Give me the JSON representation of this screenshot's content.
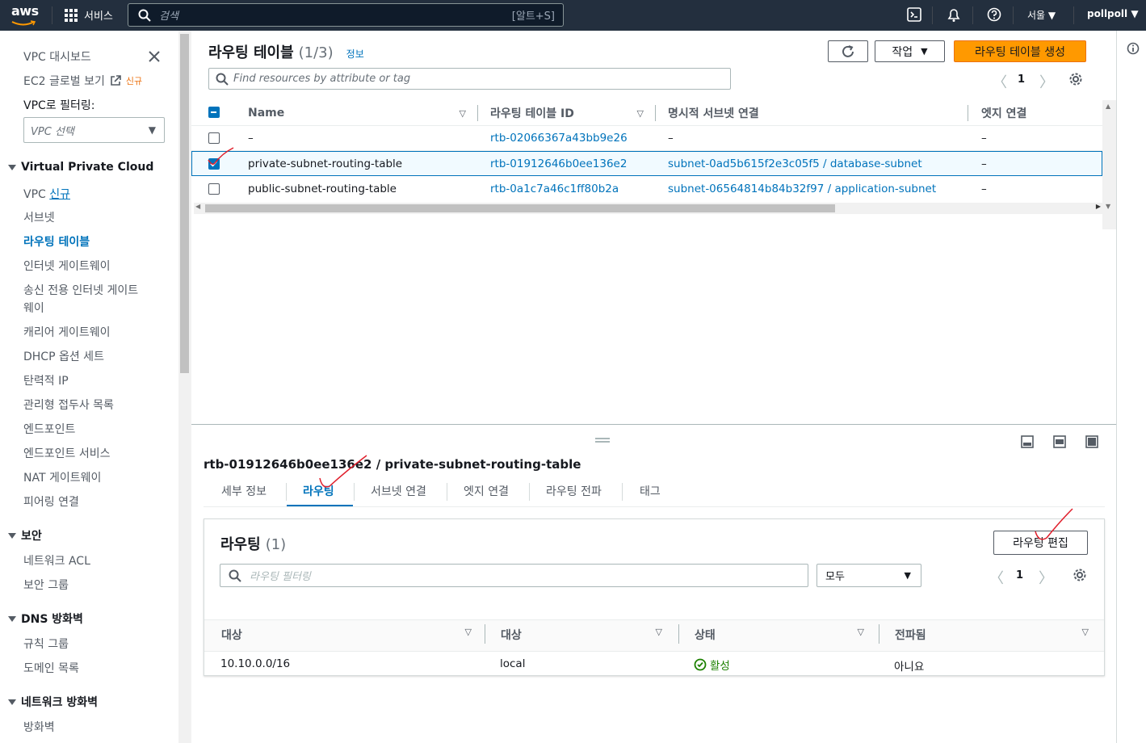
{
  "topbar": {
    "logo": "aws",
    "services_label": "서비스",
    "search_placeholder": "검색",
    "search_shortcut": "[알트+S]",
    "region": "서울",
    "user": "pollpoll"
  },
  "sidebar": {
    "dashboard": "VPC 대시보드",
    "global_view": "EC2 글로벌 보기",
    "global_view_badge": "신규",
    "filter_label": "VPC로 필터링:",
    "filter_placeholder": "VPC 선택",
    "sections": [
      {
        "title": "Virtual Private Cloud"
      },
      {
        "title": "보안"
      },
      {
        "title": "DNS 방화벽"
      },
      {
        "title": "네트워크 방화벽"
      }
    ],
    "vpc_items": {
      "vpc": "VPC",
      "vpc_badge": "신규",
      "subnet": "서브넷",
      "route_tables": "라우팅 테이블",
      "igw": "인터넷 게이트웨이",
      "eigw_1": "송신 전용 인터넷 게이트",
      "eigw_2": "웨이",
      "cgw": "캐리어 게이트웨이",
      "dhcp": "DHCP 옵션 세트",
      "eip": "탄력적 IP",
      "managed_prefix": "관리형 접두사 목록",
      "endpoints": "엔드포인트",
      "endpoint_services": "엔드포인트 서비스",
      "nat": "NAT 게이트웨이",
      "peering": "피어링 연결"
    },
    "security_items": {
      "nacl": "네트워크 ACL",
      "sg": "보안 그룹"
    },
    "dns_items": {
      "rule_groups": "규칙 그룹",
      "domain_lists": "도메인 목록"
    },
    "nfw_items": {
      "firewalls": "방화벽"
    }
  },
  "list": {
    "title": "라우팅 테이블",
    "count": "(1/3)",
    "info": "정보",
    "refresh_icon": "refresh-icon",
    "actions_label": "작업",
    "create_label": "라우팅 테이블 생성",
    "filter_placeholder": "Find resources by attribute or tag",
    "page": "1",
    "columns": [
      "Name",
      "라우팅 테이블 ID",
      "명시적 서브넷 연결",
      "엣지 연결"
    ],
    "rows": [
      {
        "name": "–",
        "id": "rtb-02066367a43bb9e26",
        "subnet": "–",
        "edge": "–",
        "selected": false
      },
      {
        "name": "private-subnet-routing-table",
        "id": "rtb-01912646b0ee136e2",
        "subnet": "subnet-0ad5b615f2e3c05f5 / database-subnet",
        "edge": "–",
        "selected": true
      },
      {
        "name": "public-subnet-routing-table",
        "id": "rtb-0a1c7a46c1ff80b2a",
        "subnet": "subnet-06564814b84b32f97 / application-subnet",
        "edge": "–",
        "selected": false
      }
    ]
  },
  "detail": {
    "title": "rtb-01912646b0ee136e2 / private-subnet-routing-table",
    "tabs": [
      "세부 정보",
      "라우팅",
      "서브넷 연결",
      "엣지 연결",
      "라우팅 전파",
      "태그"
    ],
    "active_tab": "라우팅",
    "routes": {
      "title": "라우팅",
      "count": "(1)",
      "edit_label": "라우팅 편집",
      "filter_placeholder": "라우팅 필터링",
      "select_value": "모두",
      "page": "1",
      "columns": [
        "대상",
        "대상",
        "상태",
        "전파됨"
      ],
      "rows": [
        {
          "destination": "10.10.0.0/16",
          "target": "local",
          "status": "활성",
          "propagated": "아니요"
        }
      ]
    }
  },
  "colors": {
    "topbar": "#232f3e",
    "accent": "#0073bb",
    "primary": "#ff9900",
    "success": "#1d8102"
  }
}
